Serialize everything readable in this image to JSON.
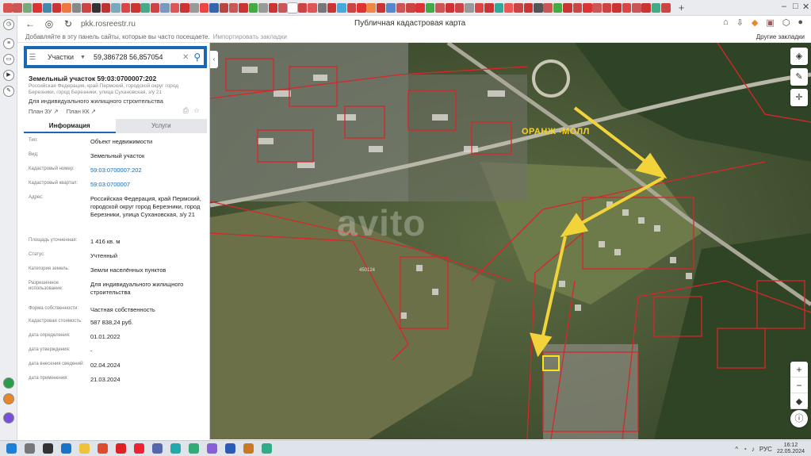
{
  "browser": {
    "url": "pkk.rosreestr.ru",
    "page_title": "Публичная кадастровая карта",
    "bookmark_hint": "Добавляйте в эту панель сайты, которые вы часто посещаете.",
    "bookmark_import": "Импортировать закладки",
    "other_bookmarks": "Другие закладки",
    "tab_colors": [
      "#d9534f",
      "#c55",
      "#7a7",
      "#d33",
      "#48a",
      "#c33",
      "#e74",
      "#888",
      "#c44",
      "#333",
      "#b33",
      "#7ab",
      "#d44",
      "#c33",
      "#4a8",
      "#c44",
      "#79b",
      "#d55",
      "#c33",
      "#999",
      "#e44",
      "#36a",
      "#b44",
      "#c55",
      "#c33",
      "#4a4",
      "#999",
      "#c33",
      "#c55",
      "#39c",
      "#c44",
      "#d55",
      "#777",
      "#c33",
      "#4ad",
      "#c44",
      "#d33",
      "#e84",
      "#c33",
      "#58c",
      "#c55",
      "#c44",
      "#d33",
      "#4a4",
      "#c55",
      "#c33",
      "#c44",
      "#999",
      "#d44",
      "#c33",
      "#3a9",
      "#e55",
      "#c44",
      "#c33",
      "#555",
      "#c55",
      "#4a4",
      "#c33",
      "#c44",
      "#d33",
      "#c55",
      "#c44",
      "#c33",
      "#d44",
      "#c55",
      "#c33",
      "#4a8",
      "#c44"
    ],
    "active_tab_index": 29
  },
  "search": {
    "category": "Участки",
    "value": "59,386728 56,857054"
  },
  "object": {
    "title": "Земельный участок 59:03:0700007:202",
    "address_short": "Российская Федерация, край Пермский, городской округ город Березники, город Березники, улица Сухановская, з/у 21",
    "use": "Для индивидуального жилищного строительства",
    "plan_zu": "План ЗУ",
    "plan_kk": "План КК"
  },
  "tabs": {
    "info": "Информация",
    "services": "Услуги"
  },
  "attributes": [
    {
      "key": "Тип:",
      "value": "Объект недвижимости",
      "link": false
    },
    {
      "key": "Вид:",
      "value": "Земельный участок",
      "link": false
    },
    {
      "key": "Кадастровый номер:",
      "value": "59:03:0700007:202",
      "link": true
    },
    {
      "key": "Кадастровый квартал:",
      "value": "59:03:0700007",
      "link": true
    },
    {
      "key": "Адрес:",
      "value": "Российская Федерация, край Пермский, городской округ город Березники, город Березники, улица Сухановская, з/у 21",
      "link": false
    },
    {
      "key": "Площадь уточненная:",
      "value": "1 416 кв. м",
      "link": false
    },
    {
      "key": "Статус:",
      "value": "Учтенный",
      "link": false
    },
    {
      "key": "Категория земель:",
      "value": "Земли населённых пунктов",
      "link": false
    },
    {
      "key": "Разрешенное использование:",
      "value": "Для индивидуального жилищного строительства",
      "link": false
    },
    {
      "key": "Форма собственности:",
      "value": "Частная собственность",
      "link": false
    },
    {
      "key": "Кадастровая стоимость:",
      "value": "587 838,24 руб.",
      "link": false
    },
    {
      "key": "дата определения:",
      "value": "01.01.2022",
      "link": false
    },
    {
      "key": "дата утверждения:",
      "value": "-",
      "link": false
    },
    {
      "key": "дата внесения сведений:",
      "value": "02.04.2024",
      "link": false
    },
    {
      "key": "дата применения:",
      "value": "21.03.2024",
      "link": false
    }
  ],
  "map": {
    "mall_label": "ОРАНЖ -МОЛЛ",
    "watermark": "avito",
    "parcel_label": "450124",
    "arrow_color": "#f2d43a",
    "boundary_color": "#d8262a"
  },
  "taskbar": {
    "lang": "РУС",
    "time": "16:12",
    "date": "22.05.2024"
  }
}
